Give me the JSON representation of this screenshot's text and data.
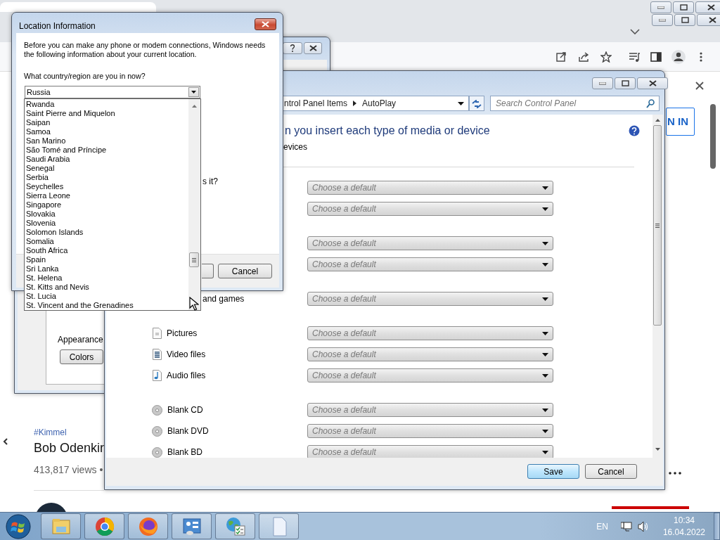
{
  "browser": {
    "page": {
      "sign_in_button": "N IN",
      "hashtag": "#Kimmel",
      "video_title": "Bob Odenkir",
      "views": "413,817 views •"
    }
  },
  "display_dialog": {
    "appearance_label": "Appearance",
    "colors_button": "Colors"
  },
  "autoplay_window": {
    "breadcrumb": [
      "ntrol Panel Items",
      "AutoPlay"
    ],
    "search": {
      "placeholder": "Search Control Panel"
    },
    "heading": "n you insert each type of media or device",
    "subheading": "evices",
    "groups": [
      {
        "rows": [
          {
            "kind": "text",
            "label": "s it?",
            "value": "Choose a default"
          },
          {
            "kind": "text",
            "value": "Choose a default"
          }
        ]
      },
      {
        "rows": [
          {
            "kind": "text",
            "value": "Choose a default"
          },
          {
            "kind": "text",
            "value": "Choose a default"
          }
        ]
      },
      {
        "rows": [
          {
            "kind": "text",
            "label": "and games",
            "value": "Choose a default"
          }
        ]
      },
      {
        "rows": [
          {
            "kind": "image",
            "label": "Pictures",
            "value": "Choose a default"
          },
          {
            "kind": "video",
            "label": "Video files",
            "value": "Choose a default"
          },
          {
            "kind": "audio",
            "label": "Audio files",
            "value": "Choose a default"
          }
        ]
      },
      {
        "rows": [
          {
            "kind": "disc",
            "label": "Blank CD",
            "value": "Choose a default"
          },
          {
            "kind": "disc",
            "label": "Blank DVD",
            "value": "Choose a default"
          },
          {
            "kind": "disc",
            "label": "Blank BD",
            "value": "Choose a default"
          }
        ]
      }
    ],
    "buttons": [
      {
        "label": "Save",
        "default": true
      },
      {
        "label": "Cancel",
        "default": false
      }
    ]
  },
  "location_dialog": {
    "title": "Location Information",
    "intro": "Before you can make any phone or modem connections, Windows needs the following information about your current location.",
    "question": "What country/region are you in now?",
    "country": {
      "value": "Russia"
    },
    "country_list": [
      "Rwanda",
      "Saint Pierre and Miquelon",
      "Saipan",
      "Samoa",
      "San Marino",
      "São Tomé and Príncipe",
      "Saudi Arabia",
      "Senegal",
      "Serbia",
      "Seychelles",
      "Sierra Leone",
      "Singapore",
      "Slovakia",
      "Slovenia",
      "Solomon Islands",
      "Somalia",
      "South Africa",
      "Spain",
      "Sri Lanka",
      "St. Helena",
      "St. Kitts and Nevis",
      "St. Lucia",
      "St. Vincent and the Grenadines"
    ],
    "buttons": [
      "Cancel"
    ]
  },
  "taskbar": {
    "language": "EN",
    "time": "10:34",
    "date": "16.04.2022"
  }
}
